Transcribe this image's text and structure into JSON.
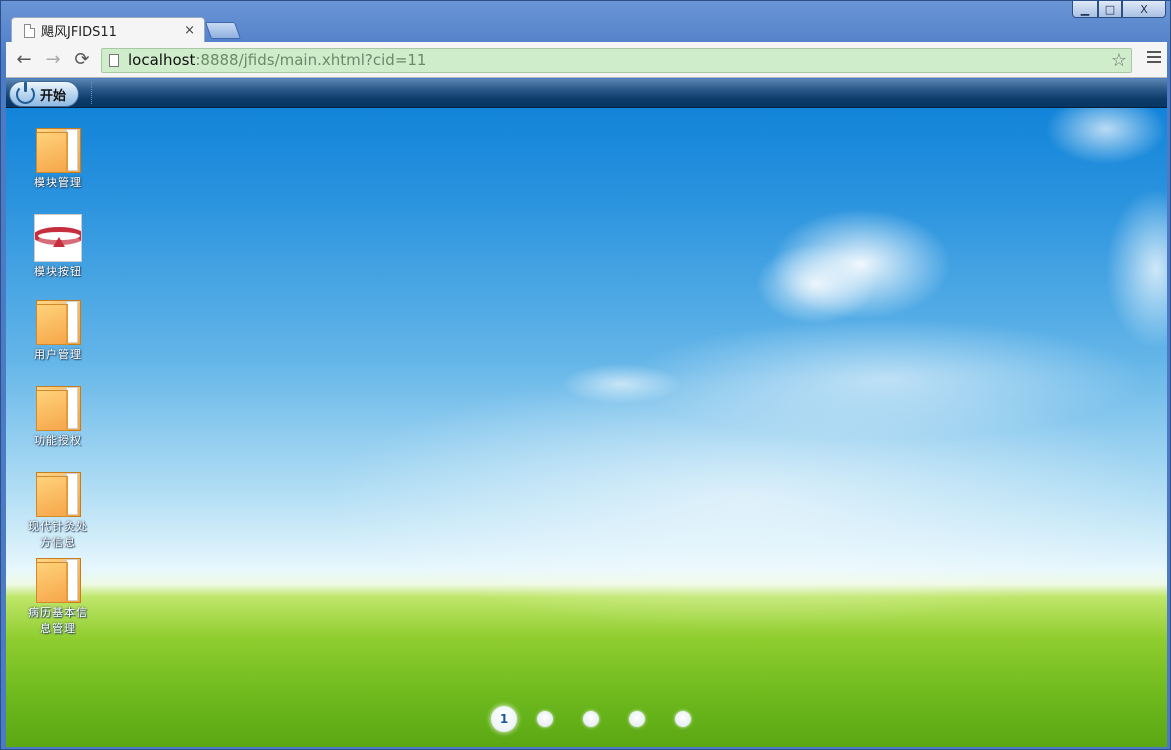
{
  "browser": {
    "tab_title": "飓风JFIDS11",
    "tab_close": "×",
    "url_host": "localhost",
    "url_rest": ":8888/jfids/main.xhtml?cid=11",
    "window_controls": {
      "minimize": "▁",
      "maximize": "□",
      "close": "X"
    },
    "nav": {
      "back": "←",
      "forward": "→",
      "reload": "⟳",
      "star": "☆"
    }
  },
  "taskbar": {
    "start_label": "开始"
  },
  "desktop": {
    "icons": [
      {
        "label": "模块管理",
        "icon": "folder-icon"
      },
      {
        "label": "模块按钮",
        "icon": "picture-icon"
      },
      {
        "label": "用户管理",
        "icon": "folder-icon"
      },
      {
        "label": "功能授权",
        "icon": "folder-icon"
      },
      {
        "label": "现代针灸处方信息",
        "icon": "folder-icon"
      },
      {
        "label": "病历基本信息管理",
        "icon": "folder-icon"
      }
    ],
    "pager": {
      "current": "1",
      "pages": 5
    }
  },
  "colors": {
    "sky_top": "#0a7fd8",
    "grass": "#6cb81d",
    "omnibox": "#cfeccb",
    "taskbar": "#0d3d6b"
  }
}
